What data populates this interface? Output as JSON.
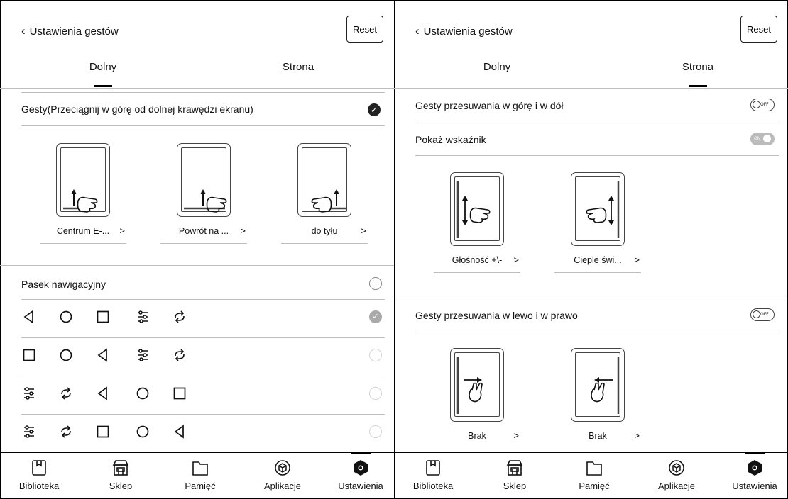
{
  "left": {
    "header": {
      "back_label": "Ustawienia gestów",
      "reset_label": "Reset"
    },
    "tabs": [
      {
        "label": "Dolny",
        "active": true
      },
      {
        "label": "Strona",
        "active": false
      }
    ],
    "gestures_section": {
      "label": "Gesty(Przeciągnij w górę od dolnej krawędzi ekranu)",
      "checked": true
    },
    "gestures": [
      {
        "label": "Centrum E-..."
      },
      {
        "label": "Powrót na ..."
      },
      {
        "label": "do tyłu"
      }
    ],
    "navbar_section": {
      "label": "Pasek nawigacyjny"
    },
    "nav_rows": [
      {
        "icons": [
          "back-triangle-icon",
          "home-circle-icon",
          "square-icon",
          "sliders-icon",
          "refresh-icon"
        ],
        "selected": true
      },
      {
        "icons": [
          "square-icon",
          "home-circle-icon",
          "back-triangle-icon",
          "sliders-icon",
          "refresh-icon"
        ],
        "selected": false
      },
      {
        "icons": [
          "sliders-icon",
          "refresh-icon",
          "back-triangle-icon",
          "home-circle-icon",
          "square-icon"
        ],
        "selected": false
      },
      {
        "icons": [
          "sliders-icon",
          "refresh-icon",
          "square-icon",
          "home-circle-icon",
          "back-triangle-icon"
        ],
        "selected": false
      }
    ]
  },
  "right": {
    "header": {
      "back_label": "Ustawienia gestów",
      "reset_label": "Reset"
    },
    "tabs": [
      {
        "label": "Dolny",
        "active": false
      },
      {
        "label": "Strona",
        "active": true
      }
    ],
    "updown": {
      "label": "Gesty przesuwania w górę i w dół",
      "toggle": "OFF"
    },
    "indicator": {
      "label": "Pokaż wskaźnik",
      "toggle": "ON"
    },
    "side_gestures": [
      {
        "label": "Głośność +\\-"
      },
      {
        "label": "Cieple świ..."
      }
    ],
    "leftright": {
      "label": "Gesty przesuwania w lewo i w prawo",
      "toggle": "OFF"
    },
    "lr_gestures": [
      {
        "label": "Brak"
      },
      {
        "label": "Brak"
      }
    ]
  },
  "bottom_nav": [
    {
      "label": "Biblioteka",
      "icon": "library-icon"
    },
    {
      "label": "Sklep",
      "icon": "store-icon"
    },
    {
      "label": "Pamięć",
      "icon": "folder-icon"
    },
    {
      "label": "Aplikacje",
      "icon": "apps-cube-icon"
    },
    {
      "label": "Ustawienia",
      "icon": "settings-hex-icon",
      "active": true
    }
  ],
  "chevron": ">"
}
